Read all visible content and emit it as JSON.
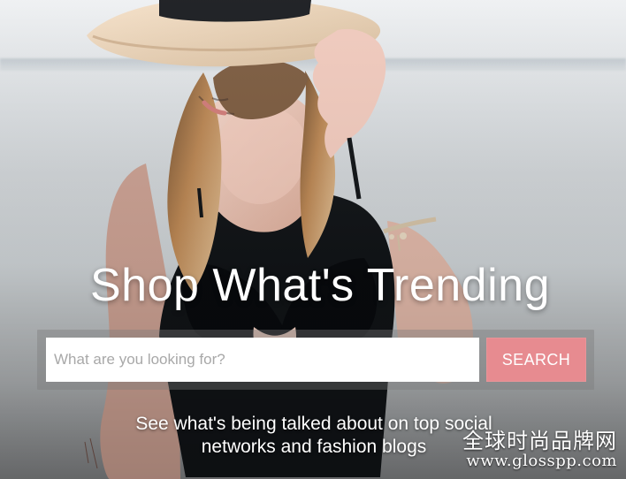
{
  "hero": {
    "headline": "Shop What's Trending",
    "search": {
      "placeholder": "What are you looking for?",
      "button_label": "SEARCH"
    },
    "subtext_line1": "See what's being talked about on top social",
    "subtext_line2": "networks and fashion blogs"
  },
  "watermark": {
    "line1": "全球时尚品牌网",
    "line2": "www.glosspp.com"
  },
  "colors": {
    "button": "#e78b90",
    "overlay": "#787878"
  },
  "icons": {
    "hero_image": "woman-with-straw-hat-photo"
  }
}
